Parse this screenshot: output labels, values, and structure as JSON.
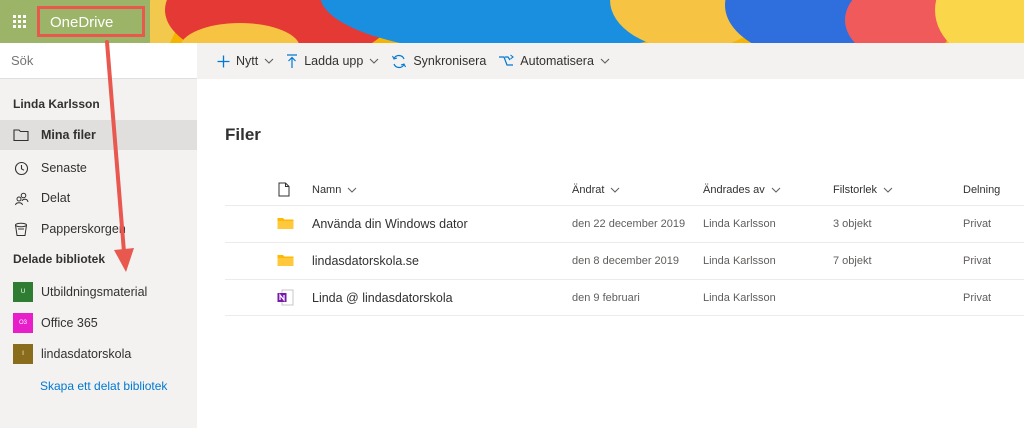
{
  "header": {
    "app_name": "OneDrive"
  },
  "search": {
    "placeholder": "Sök"
  },
  "leftnav": {
    "user_name": "Linda Karlsson",
    "items": [
      {
        "label": "Mina filer",
        "icon": "folder-icon",
        "selected": true
      },
      {
        "label": "Senaste",
        "icon": "clock-icon"
      },
      {
        "label": "Delat",
        "icon": "people-icon"
      },
      {
        "label": "Papperskorgen",
        "icon": "trash-icon"
      }
    ],
    "shared_title": "Delade bibliotek",
    "libraries": [
      {
        "label": "Utbildningsmaterial",
        "badge": "U",
        "color": "#2e7d32"
      },
      {
        "label": "Office 365",
        "badge": "O3",
        "color": "#e91ecb"
      },
      {
        "label": "lindasdatorskola",
        "badge": "l",
        "color": "#8a6d1c"
      }
    ],
    "create_link": "Skapa ett delat bibliotek"
  },
  "toolbar": {
    "new_label": "Nytt",
    "upload_label": "Ladda upp",
    "sync_label": "Synkronisera",
    "automate_label": "Automatisera"
  },
  "main": {
    "title": "Filer",
    "columns": {
      "name": "Namn",
      "modified": "Ändrat",
      "modified_by": "Ändrades av",
      "size": "Filstorlek",
      "sharing": "Delning"
    },
    "rows": [
      {
        "name": "Använda din Windows dator",
        "modified": "den 22 december 2019",
        "modified_by": "Linda Karlsson",
        "size": "3 objekt",
        "sharing": "Privat",
        "icon": "folder-icon"
      },
      {
        "name": "lindasdatorskola.se",
        "modified": "den 8 december 2019",
        "modified_by": "Linda Karlsson",
        "size": "7 objekt",
        "sharing": "Privat",
        "icon": "folder-icon"
      },
      {
        "name": "Linda @ lindasdatorskola",
        "modified": "den 9 februari",
        "modified_by": "Linda Karlsson",
        "size": "",
        "sharing": "Privat",
        "icon": "onenote-icon"
      }
    ]
  },
  "colors": {
    "accent": "#0078d4",
    "annotation": "#e8584f",
    "folder": "#ffb900",
    "onenote": "#7719aa"
  }
}
